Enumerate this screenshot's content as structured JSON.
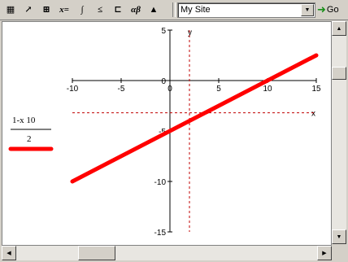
{
  "toolbar": {
    "buttons": [
      {
        "name": "calculator-icon",
        "glyph": "▦"
      },
      {
        "name": "graph-icon",
        "glyph": "↗"
      },
      {
        "name": "matrix-icon",
        "glyph": "⊞"
      },
      {
        "name": "evaluation-icon",
        "glyph": "x="
      },
      {
        "name": "calculus-icon",
        "glyph": "∫"
      },
      {
        "name": "boolean-icon",
        "glyph": "≤"
      },
      {
        "name": "programming-icon",
        "glyph": "⊏"
      },
      {
        "name": "greek-icon",
        "glyph": "αβ"
      },
      {
        "name": "symbolic-icon",
        "glyph": "▲"
      }
    ],
    "url_value": "My Site",
    "go_label": "Go"
  },
  "graph": {
    "expression_top": "1-x 10",
    "expression_bottom": "2",
    "trace_color": "#ff0000",
    "marker_color": "#c00000",
    "x_ticks": [
      "-10",
      "-5",
      "0",
      "5",
      "10",
      "15"
    ],
    "y_ticks": [
      "5",
      "0",
      "-5",
      "-10",
      "-15"
    ],
    "x_axis_name": "x",
    "y_axis_name": "y"
  },
  "chart_data": {
    "type": "line",
    "x": [
      -10,
      15
    ],
    "y": [
      -10,
      2.5
    ],
    "xlim": [
      -10,
      15
    ],
    "ylim": [
      -15,
      5
    ],
    "marker_x": 2,
    "marker_y": -3.2,
    "grid": false
  }
}
